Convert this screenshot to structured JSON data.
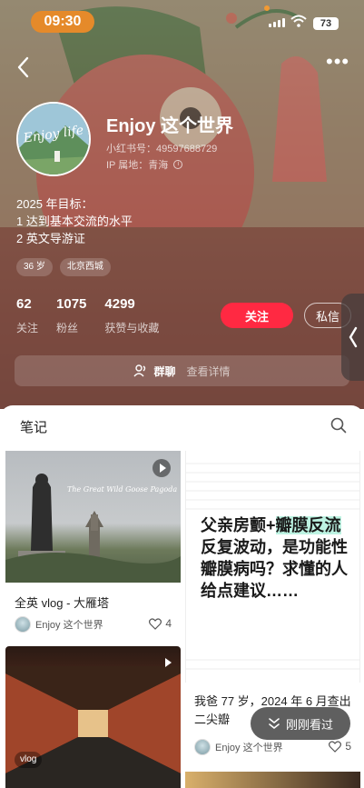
{
  "status_bar": {
    "time": "09:30",
    "battery": "73"
  },
  "profile": {
    "nickname": "Enjoy 这个世界",
    "avatar_text": "Enjoy life",
    "red_id": "小红书号：49597688729",
    "ip": "IP 属地：青海",
    "bio_lines": [
      "2025 年目标：",
      "1 达到基本交流的水平",
      "2 英文导游证"
    ],
    "tags": [
      "36 岁",
      "北京西城"
    ],
    "stats": [
      {
        "num": "62",
        "label": "关注"
      },
      {
        "num": "1075",
        "label": "粉丝"
      },
      {
        "num": "4299",
        "label": "获赞与收藏"
      }
    ],
    "follow_label": "关注",
    "dm_label": "私信",
    "group_label": "群聊",
    "group_sub": "查看详情"
  },
  "notes_tab": {
    "label": "笔记"
  },
  "cards": [
    {
      "title": "全英 vlog - 大雁塔",
      "author": "Enjoy 这个世界",
      "likes": "4",
      "overlay": "The Great Wild Goose Pagoda"
    },
    {
      "text_parts": [
        "父亲房颤+",
        "瓣膜",
        "反流",
        "反复波动，是功能性瓣膜病吗？求懂的人给点建议……"
      ],
      "caption": "我爸 77 岁，2024 年 6 月查出二尖瓣",
      "author": "Enjoy 这个世界",
      "likes": "5"
    },
    {
      "vlog_tag": "vlog"
    }
  ],
  "recent_button": "刚刚看过",
  "colors": {
    "accent": "#ff2942",
    "time_pill": "#e58a2a",
    "highlight": "#bdf3e2"
  }
}
